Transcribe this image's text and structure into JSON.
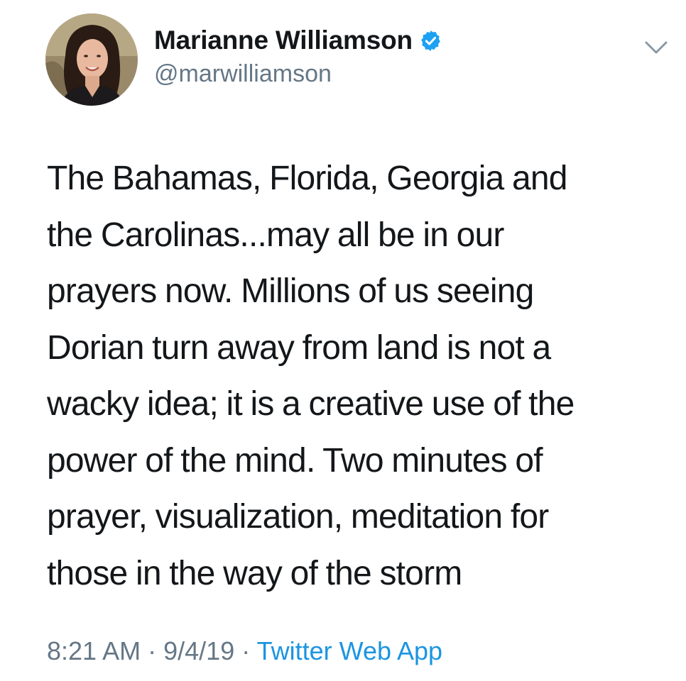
{
  "user": {
    "display_name": "Marianne Williamson",
    "handle": "@marwilliamson",
    "verified": true,
    "avatar_icon": "profile-photo"
  },
  "tweet": {
    "lines": [
      "The Bahamas, Florida, Georgia and",
      "the Carolinas...may all be in our",
      "prayers now. Millions of us seeing",
      "Dorian turn away from land is not a",
      "wacky idea; it is a creative use of the",
      "power of the mind. Two minutes of",
      "prayer, visualization, meditation for",
      "those in the way of the storm"
    ]
  },
  "meta": {
    "time": "8:21 AM",
    "separator": "·",
    "date": "9/4/19",
    "source": "Twitter Web App"
  },
  "icons": {
    "verified": "verified-badge-icon",
    "more": "chevron-down-icon"
  },
  "colors": {
    "text": "#14171a",
    "secondary": "#657786",
    "link": "#1b95e0",
    "verified": "#1da1f2"
  }
}
